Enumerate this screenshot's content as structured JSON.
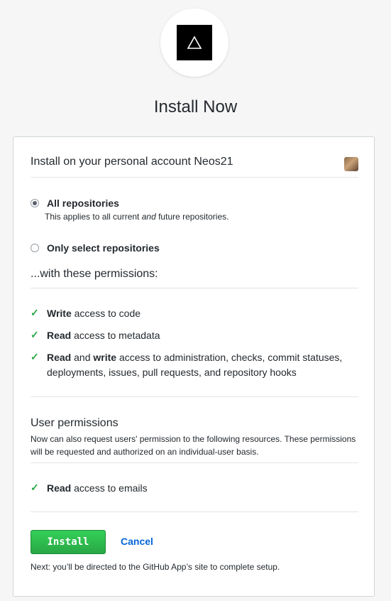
{
  "header": {
    "logo_glyph": "Δ",
    "title": "Install Now"
  },
  "account": {
    "label": "Install on your personal account Neos21"
  },
  "repositories": {
    "all": {
      "label": "All repositories",
      "note_prefix": "This applies to all current ",
      "note_emphasis": "and",
      "note_suffix": " future repositories.",
      "selected": true
    },
    "select": {
      "label": "Only select repositories",
      "selected": false
    }
  },
  "permissions": {
    "heading": "...with these permissions:",
    "items": [
      {
        "bold": "Write",
        "text": " access to code"
      },
      {
        "bold": "Read",
        "text": " access to metadata"
      },
      {
        "bold": "Read",
        "mid": " and ",
        "bold2": "write",
        "text": " access to administration, checks, commit statuses, deployments, issues, pull requests, and repository hooks"
      }
    ]
  },
  "user_permissions": {
    "title": "User permissions",
    "description": "Now can also request users' permission to the following resources. These permissions will be requested and authorized on an individual-user basis.",
    "items": [
      {
        "bold": "Read",
        "text": " access to emails"
      }
    ]
  },
  "actions": {
    "install_label": "Install",
    "cancel_label": "Cancel",
    "next_note": "Next: you’ll be directed to the GitHub App’s site to complete setup."
  },
  "colors": {
    "accent_green": "#28a745",
    "link_blue": "#0366d6"
  },
  "icons": {
    "check": "✓",
    "avatar": "cat-avatar"
  }
}
